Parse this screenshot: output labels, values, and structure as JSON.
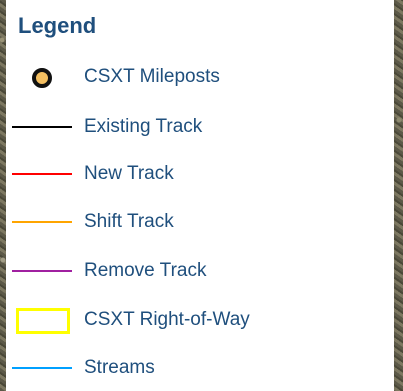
{
  "legend": {
    "title": "Legend",
    "items": [
      {
        "label": "CSXT Mileposts",
        "symbol": "point",
        "icon": "milepost-point-icon",
        "color": "#111111",
        "fill": "#f4bf61"
      },
      {
        "label": "Existing Track",
        "symbol": "line",
        "icon": "existing-track-line-icon",
        "color": "#000000"
      },
      {
        "label": "New Track",
        "symbol": "line",
        "icon": "new-track-line-icon",
        "color": "#ff0000"
      },
      {
        "label": "Shift Track",
        "symbol": "line",
        "icon": "shift-track-line-icon",
        "color": "#ffa500"
      },
      {
        "label": "Remove Track",
        "symbol": "line",
        "icon": "remove-track-line-icon",
        "color": "#a020a0"
      },
      {
        "label": "CSXT Right-of-Way",
        "symbol": "polygon",
        "icon": "right-of-way-polygon-icon",
        "color": "#ffff00"
      },
      {
        "label": "Streams",
        "symbol": "line",
        "icon": "streams-line-icon",
        "color": "#00a0ff"
      }
    ]
  }
}
